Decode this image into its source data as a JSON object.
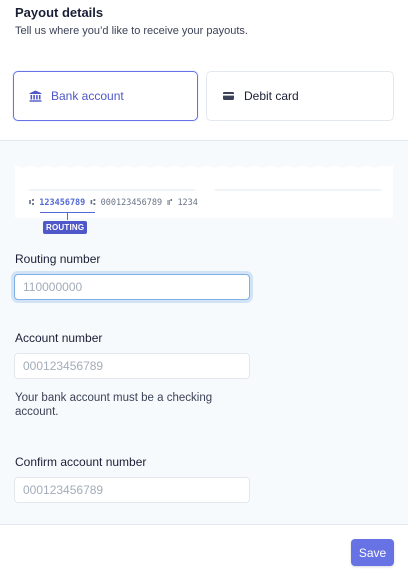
{
  "header": {
    "title": "Payout details",
    "subtitle": "Tell us where you’d like to receive your payouts."
  },
  "payout_methods": [
    {
      "label": "Bank account",
      "icon": "bank-icon",
      "selected": true
    },
    {
      "label": "Debit card",
      "icon": "credit-card-icon",
      "selected": false
    }
  ],
  "check_illustration": {
    "routing": "123456789",
    "account": "000123456789",
    "check_number": "1234",
    "tag": "ROUTING"
  },
  "form": {
    "routing": {
      "label": "Routing number",
      "placeholder": "110000000"
    },
    "account": {
      "label": "Account number",
      "placeholder": "000123456789",
      "help": "Your bank account must be a checking account."
    },
    "confirm": {
      "label": "Confirm account number",
      "placeholder": "000123456789"
    }
  },
  "footer": {
    "save_label": "Save"
  },
  "colors": {
    "accent": "#6772e5",
    "focus_ring": "#7fb0e6"
  }
}
